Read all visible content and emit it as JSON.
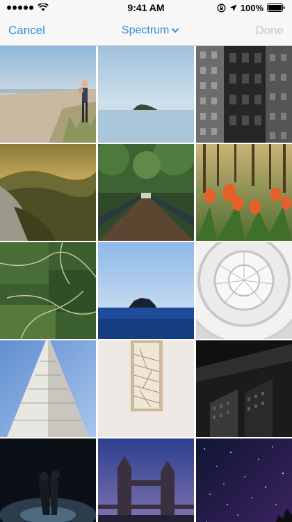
{
  "status_bar": {
    "time": "9:41 AM",
    "battery": "100%",
    "icons": [
      "signal-dots-icon",
      "wifi-icon",
      "orientation-lock-icon",
      "location-arrow-icon",
      "battery-icon"
    ]
  },
  "nav": {
    "cancel_label": "Cancel",
    "title": "Spectrum",
    "done_label": "Done",
    "accent_color": "#2f8ed8",
    "disabled_color": "#c8c8c8"
  },
  "photos": [
    {
      "subject": "beach-person"
    },
    {
      "subject": "island-sea"
    },
    {
      "subject": "building-facade"
    },
    {
      "subject": "misty-hills"
    },
    {
      "subject": "forest-bridge"
    },
    {
      "subject": "tulips"
    },
    {
      "subject": "aerial-green"
    },
    {
      "subject": "rock-sea"
    },
    {
      "subject": "spiral-ceiling"
    },
    {
      "subject": "tall-tower"
    },
    {
      "subject": "staircase"
    },
    {
      "subject": "dark-building"
    },
    {
      "subject": "couple-night"
    },
    {
      "subject": "tower-bridge"
    },
    {
      "subject": "starry-sky"
    }
  ]
}
